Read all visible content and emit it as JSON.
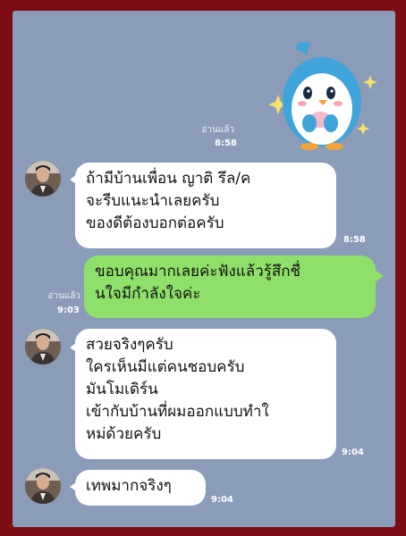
{
  "chat": {
    "read_label_1": "อ่านแล้ว",
    "time_1": "8:58",
    "msg1_text": "ถ้ามีบ้านเพื่อน ญาติ รึล/ค\nจะรีบแนะนำเลยครับ\nของดีต้องบอกต่อครับ",
    "msg1_time": "8:58",
    "msg2_text": "ขอบคุณมากเลยค่ะฟังแล้วรู้สึกชื่\nนใจมีกำลังใจค่ะ",
    "read_label_2": "อ่านแล้ว",
    "msg2_time": "9:03",
    "msg3_text": "สวยจริงๆครับ\nใครเห็นมีแต่คนชอบครับ\nมันโมเดิร์น\nเข้ากับบ้านที่ผมออกแบบทำใ\nหม่ด้วยครับ",
    "msg3_time": "9:04",
    "msg4_text": "เทพมากจริงๆ",
    "msg4_time": "9:04"
  },
  "colors": {
    "background": "#8a9cb8",
    "frame": "#7d0d14",
    "outgoing_bubble": "#8fe06a",
    "incoming_bubble": "#ffffff"
  },
  "icons": {
    "sticker": "penguin-sticker-icon",
    "avatar": "user-avatar"
  }
}
